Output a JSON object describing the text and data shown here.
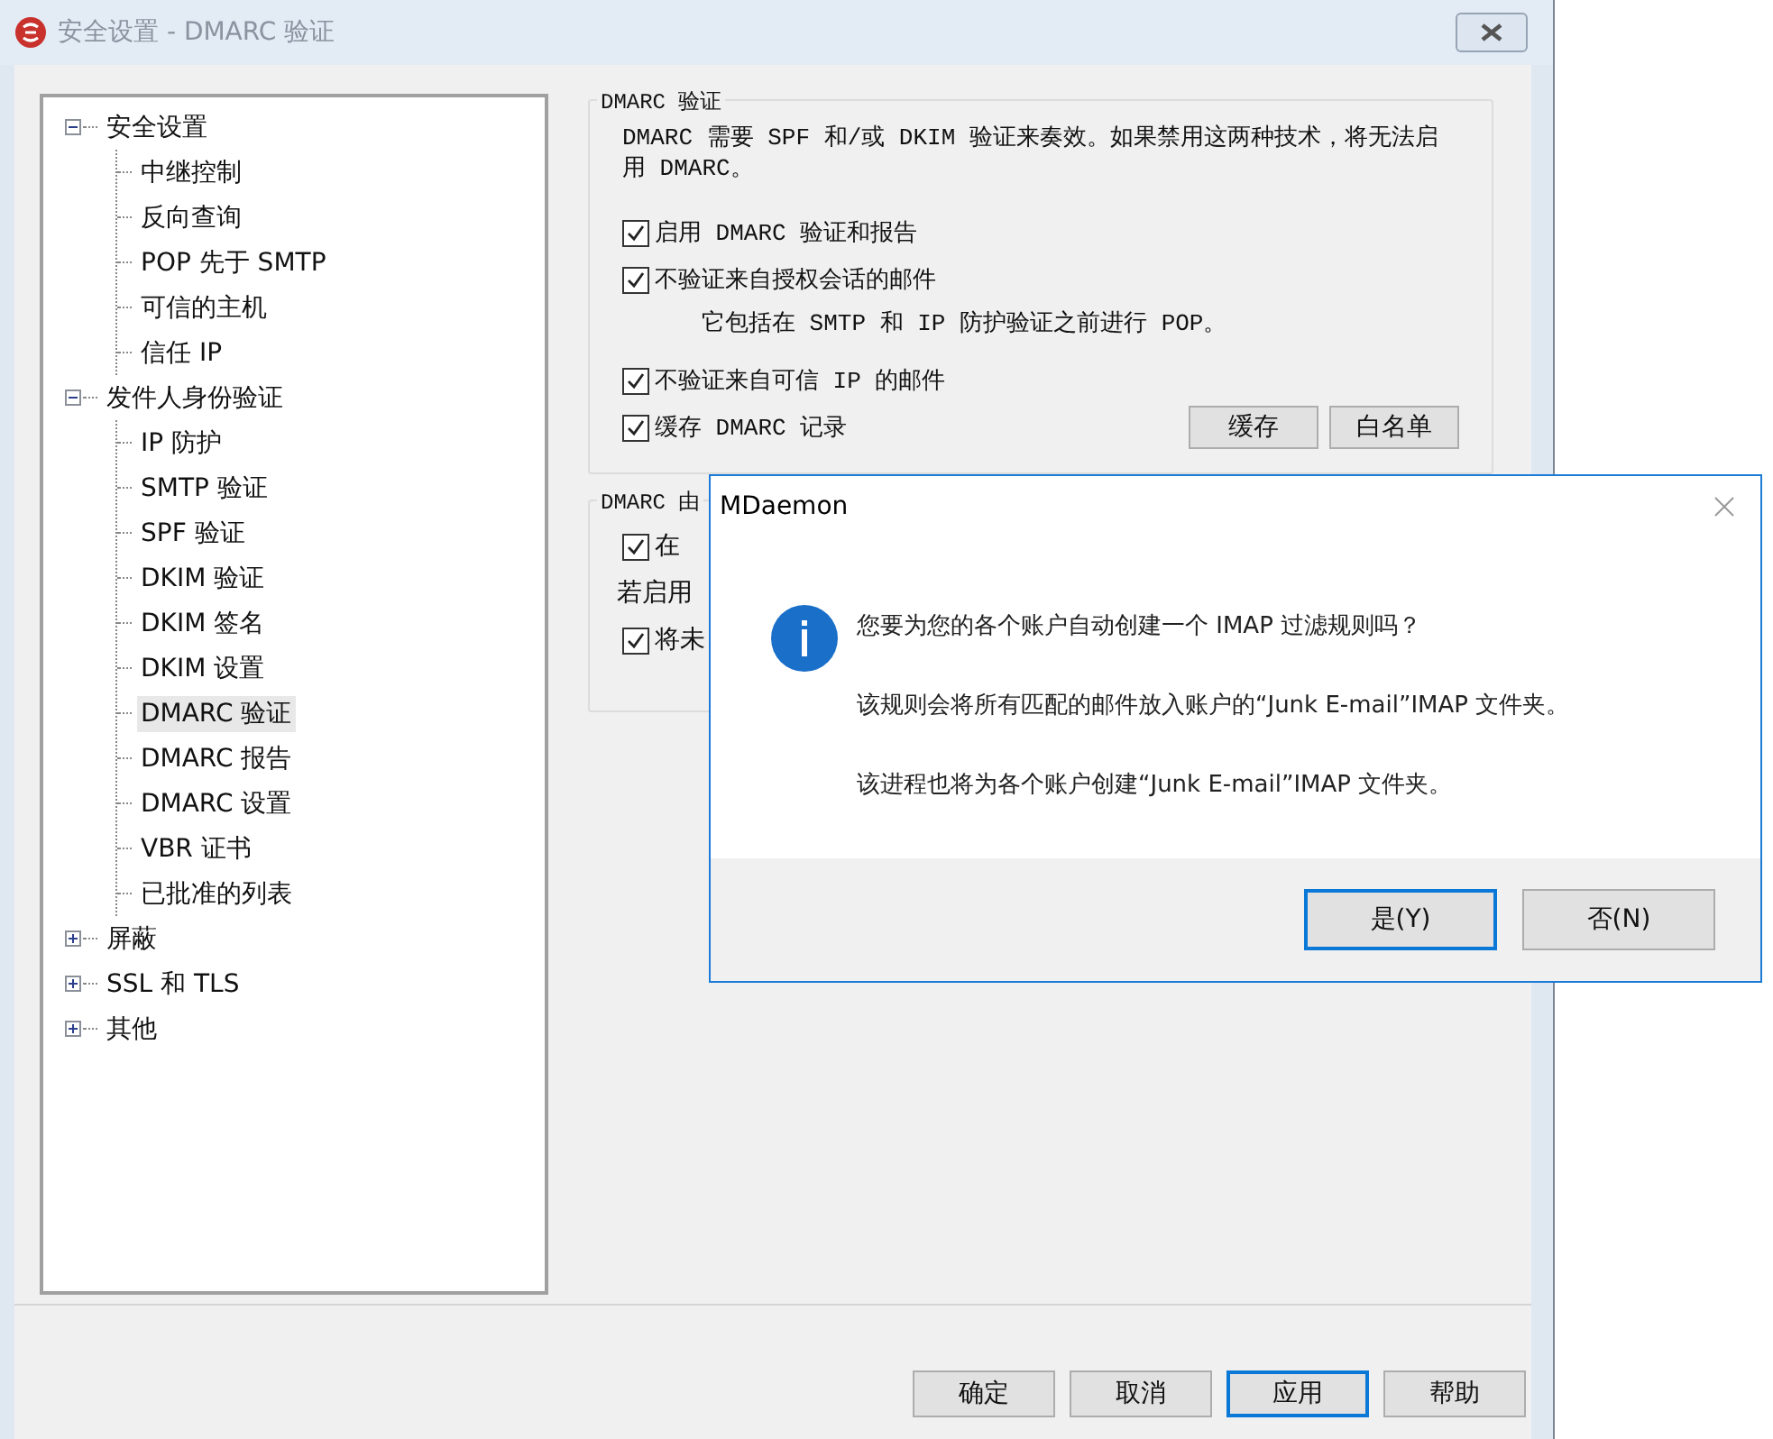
{
  "window": {
    "title": "安全设置 - DMARC 验证"
  },
  "tree": [
    {
      "label": "安全设置",
      "expanded": true,
      "selected": false,
      "children": [
        {
          "label": "中继控制",
          "selected": false
        },
        {
          "label": "反向查询",
          "selected": false
        },
        {
          "label": "POP 先于 SMTP",
          "selected": false
        },
        {
          "label": "可信的主机",
          "selected": false
        },
        {
          "label": "信任 IP",
          "selected": false
        }
      ]
    },
    {
      "label": "发件人身份验证",
      "expanded": true,
      "selected": false,
      "children": [
        {
          "label": "IP 防护",
          "selected": false
        },
        {
          "label": "SMTP 验证",
          "selected": false
        },
        {
          "label": "SPF 验证",
          "selected": false
        },
        {
          "label": "DKIM 验证",
          "selected": false
        },
        {
          "label": "DKIM 签名",
          "selected": false
        },
        {
          "label": "DKIM 设置",
          "selected": false
        },
        {
          "label": "DMARC 验证",
          "selected": true
        },
        {
          "label": "DMARC 报告",
          "selected": false
        },
        {
          "label": "DMARC 设置",
          "selected": false
        },
        {
          "label": "VBR 证书",
          "selected": false
        },
        {
          "label": "已批准的列表",
          "selected": false
        }
      ]
    },
    {
      "label": "屏蔽",
      "expanded": false,
      "selected": false
    },
    {
      "label": "SSL 和 TLS",
      "expanded": false,
      "selected": false
    },
    {
      "label": "其他",
      "expanded": false,
      "selected": false
    }
  ],
  "groups": [
    {
      "title": "DMARC 验证",
      "description": "DMARC 需要 SPF 和/或 DKIM 验证来奏效。如果禁用这两种技术，将无法启用 DMARC。",
      "items": [
        {
          "kind": "checkbox",
          "label": "启用 DMARC 验证和报告",
          "checked": true
        },
        {
          "kind": "checkbox",
          "label": "不验证来自授权会话的邮件",
          "checked": true
        },
        {
          "kind": "note",
          "label": "它包括在 SMTP 和 IP 防护验证之前进行 POP。"
        },
        {
          "kind": "checkbox",
          "label": "不验证来自可信 IP 的邮件",
          "checked": true
        },
        {
          "kind": "checkbox",
          "label": "缓存 DMARC 记录",
          "checked": true
        }
      ],
      "buttons": [
        "缓存",
        "白名单"
      ]
    },
    {
      "title": "DMARC 由",
      "items": [
        {
          "kind": "checkbox",
          "label": "在",
          "checked": true
        },
        {
          "kind": "text",
          "label": "若启用"
        },
        {
          "kind": "checkbox",
          "label": "将未",
          "checked": true
        }
      ]
    }
  ],
  "footer_buttons": [
    {
      "label": "确定",
      "focused": false
    },
    {
      "label": "取消",
      "focused": false
    },
    {
      "label": "应用",
      "focused": true
    },
    {
      "label": "帮助",
      "focused": false
    }
  ],
  "dialog": {
    "title": "MDaemon",
    "question": "您要为您的各个账户自动创建一个 IMAP 过滤规则吗？",
    "lines": [
      "该规则会将所有匹配的邮件放入账户的“Junk E-mail”IMAP 文件夹。",
      "该进程也将为各个账户创建“Junk E-mail”IMAP 文件夹。"
    ],
    "buttons": [
      {
        "label": "是(Y)",
        "focused": true
      },
      {
        "label": "否(N)",
        "focused": false
      }
    ]
  }
}
